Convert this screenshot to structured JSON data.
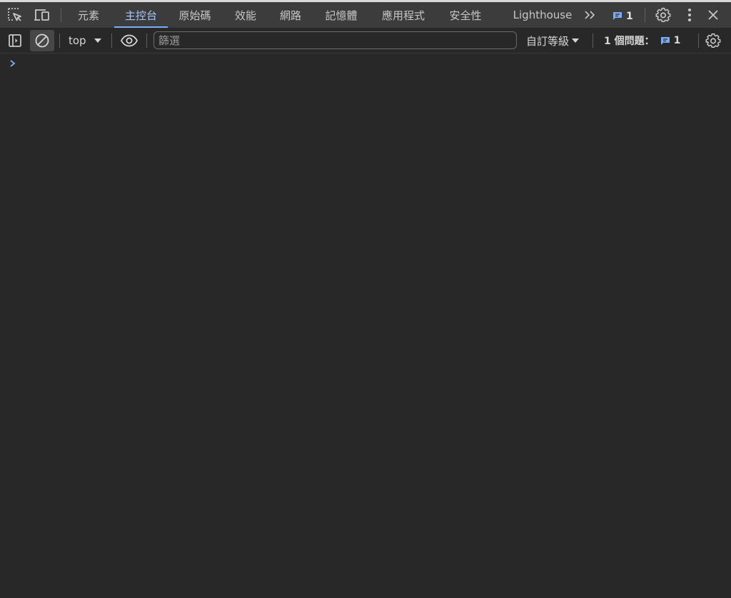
{
  "tabs": [
    {
      "label": "元素"
    },
    {
      "label": "主控台"
    },
    {
      "label": "原始碼"
    },
    {
      "label": "效能"
    },
    {
      "label": "網路"
    },
    {
      "label": "記憶體"
    },
    {
      "label": "應用程式"
    },
    {
      "label": "安全性"
    },
    {
      "label": "Lighthouse"
    }
  ],
  "active_tab": "主控台",
  "issues_badge_count": "1",
  "toolbar": {
    "context": "top",
    "filter_placeholder": "篩選",
    "levels_label": "自訂等級",
    "issues_label": "1 個問題：",
    "issues_count": "1"
  },
  "colors": {
    "accent": "#a8c7fa",
    "background": "#282828",
    "tabbar_background": "#3c3c3c",
    "issue_icon": "#7cacf8"
  },
  "icons": [
    "inspect-element-icon",
    "device-toolbar-icon",
    "more-tabs-icon",
    "issues-icon",
    "settings-icon",
    "more-options-icon",
    "close-icon",
    "sidebar-toggle-icon",
    "clear-console-icon",
    "dropdown-arrow-icon",
    "live-expression-icon",
    "console-prompt-icon"
  ]
}
